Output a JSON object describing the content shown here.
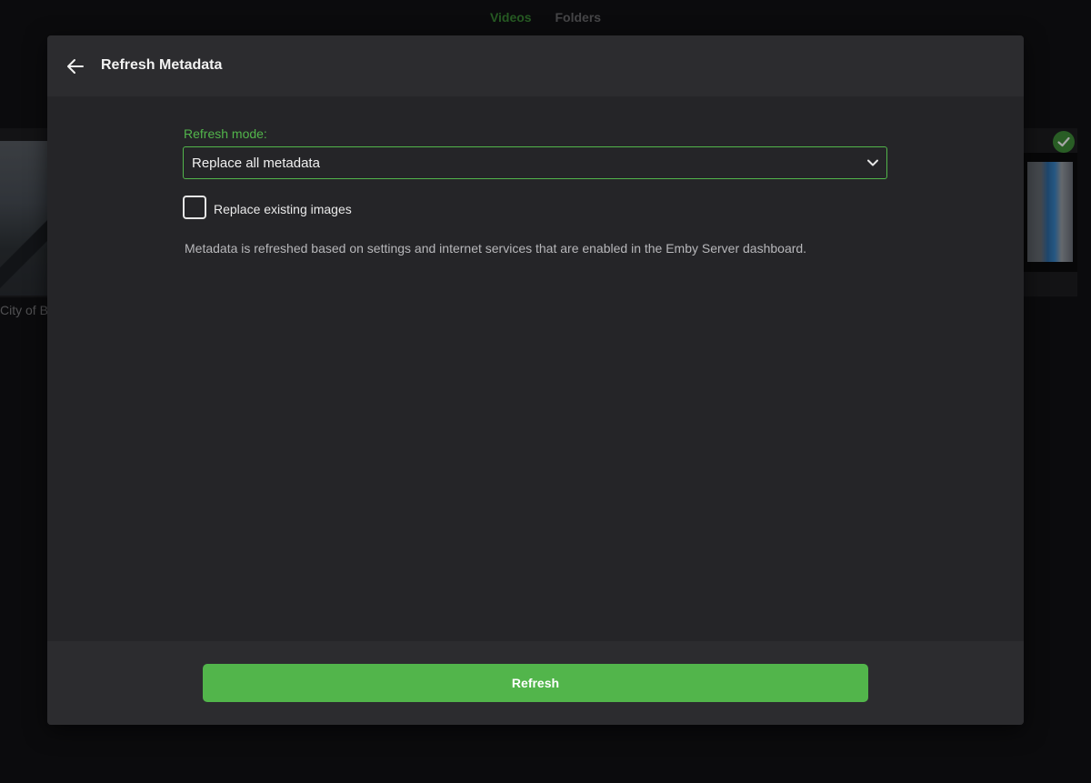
{
  "background": {
    "tabs": [
      {
        "label": "Videos",
        "active": true
      },
      {
        "label": "Folders",
        "active": false
      }
    ],
    "left_card_title": "City of B"
  },
  "dialog": {
    "title": "Refresh Metadata",
    "refresh_mode": {
      "label": "Refresh mode:",
      "selected": "Replace all metadata"
    },
    "replace_images": {
      "label": "Replace existing images",
      "checked": false
    },
    "help_text": "Metadata is refreshed based on settings and internet services that are enabled in the Emby Server dashboard.",
    "submit_label": "Refresh"
  },
  "icons": {
    "back": "arrow-left-icon",
    "dropdown": "chevron-down-icon",
    "check": "check-circle-icon"
  },
  "colors": {
    "accent": "#52b54b",
    "dialog_bg": "#252528",
    "header_bg": "#2c2c2f",
    "page_bg": "#121214"
  }
}
